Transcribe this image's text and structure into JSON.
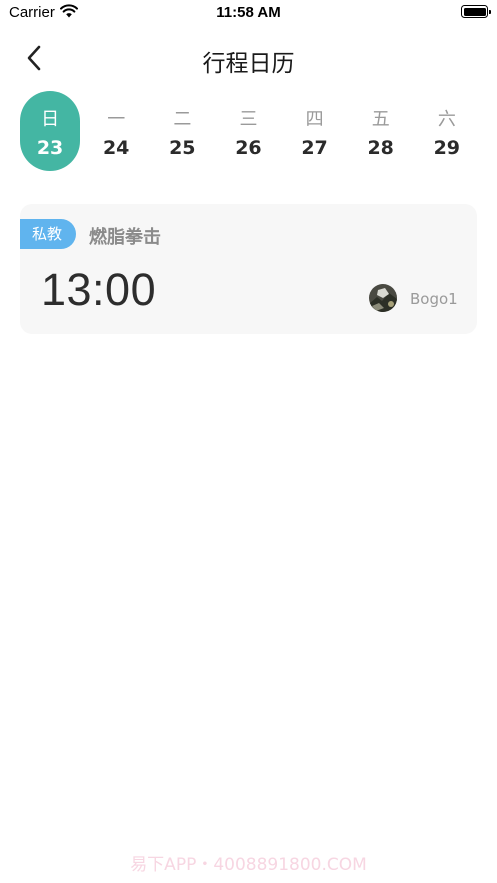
{
  "status_bar": {
    "carrier": "Carrier",
    "time": "11:58 AM",
    "wifi_icon": "wifi-icon",
    "battery_icon": "battery-icon"
  },
  "nav": {
    "back_icon": "chevron-left-icon",
    "title": "行程日历"
  },
  "week": {
    "selected_index": 0,
    "accent_color": "#44b6a3",
    "days": [
      {
        "weekday": "日",
        "date": "23"
      },
      {
        "weekday": "一",
        "date": "24"
      },
      {
        "weekday": "二",
        "date": "25"
      },
      {
        "weekday": "三",
        "date": "26"
      },
      {
        "weekday": "四",
        "date": "27"
      },
      {
        "weekday": "五",
        "date": "28"
      },
      {
        "weekday": "六",
        "date": "29"
      }
    ]
  },
  "courses": [
    {
      "type": "私教",
      "type_color": "#60b4ee",
      "name": "燃脂拳击",
      "time": "13:00",
      "coach": "Bogo1"
    }
  ],
  "watermark": "易下APP・4008891800.COM"
}
